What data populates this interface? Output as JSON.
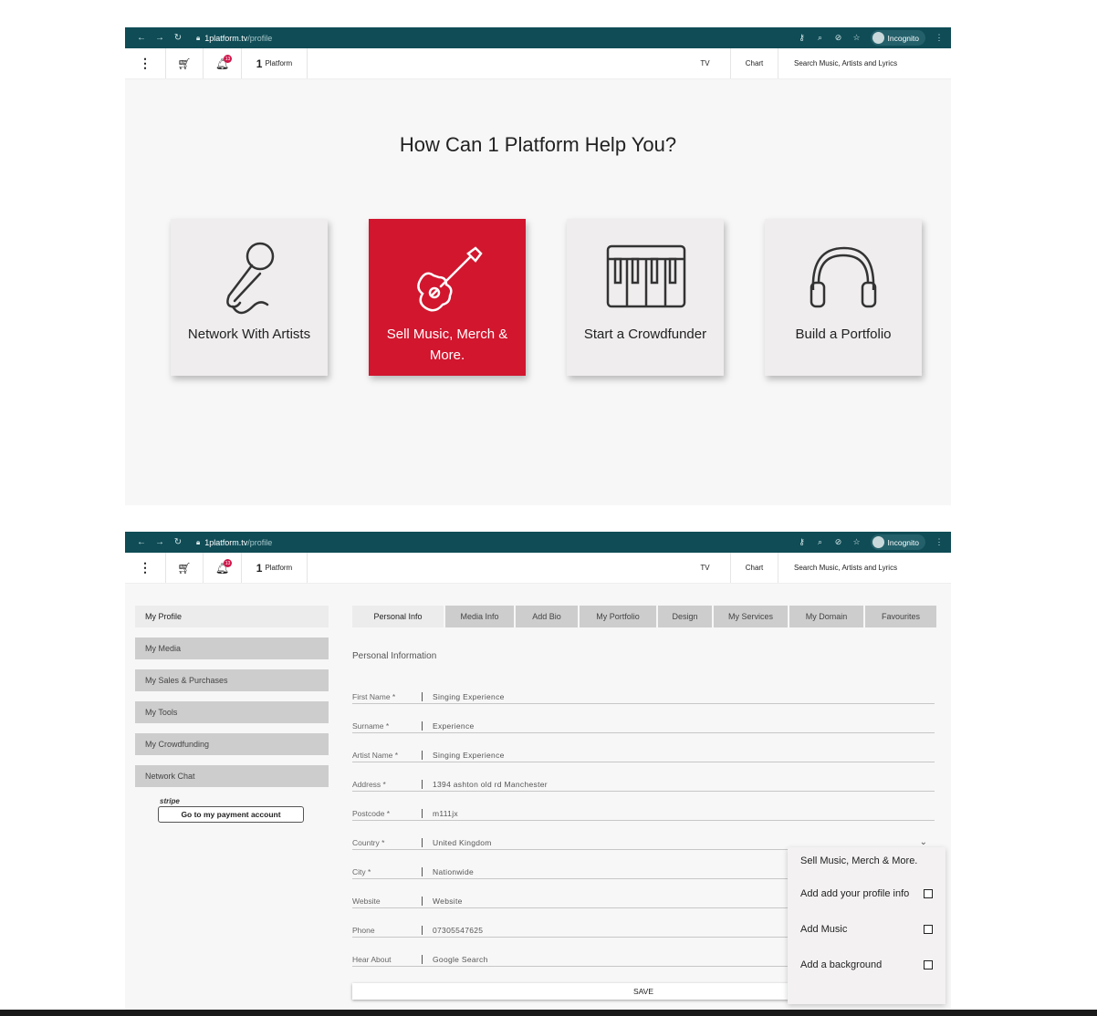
{
  "browser": {
    "url_host": "1platform.tv",
    "url_path": "/profile",
    "incognito_label": "Incognito"
  },
  "sitebar": {
    "logo_mark": "1",
    "logo_text": "Platform",
    "notification_count": "13",
    "tv_label": "TV",
    "chart_label": "Chart",
    "search_placeholder": "Search Music, Artists and Lyrics"
  },
  "help": {
    "title": "How Can 1 Platform Help You?",
    "cards": [
      {
        "label": "Network With Artists",
        "icon": "microphone-icon"
      },
      {
        "label": "Sell Music, Merch & More.",
        "icon": "guitar-icon",
        "active": true
      },
      {
        "label": "Start a Crowdfunder",
        "icon": "piano-keyboard-icon"
      },
      {
        "label": "Build a Portfolio",
        "icon": "headphones-icon"
      }
    ],
    "accent_color": "#d1162e"
  },
  "profile": {
    "nav": [
      "My Profile",
      "My Media",
      "My Sales & Purchases",
      "My Tools",
      "My Crowdfunding",
      "Network Chat"
    ],
    "stripe_label": "stripe",
    "payment_button": "Go to my payment account",
    "tabs": [
      "Personal Info",
      "Media Info",
      "Add Bio",
      "My Portfolio",
      "Design",
      "My Services",
      "My Domain",
      "Favourites"
    ],
    "form_title": "Personal Information",
    "fields": [
      {
        "label": "First Name *",
        "value": "Singing Experience"
      },
      {
        "label": "Surname *",
        "value": "Experience"
      },
      {
        "label": "Artist Name *",
        "value": "Singing Experience"
      },
      {
        "label": "Address *",
        "value": "1394 ashton old rd Manchester"
      },
      {
        "label": "Postcode *",
        "value": "m111jx"
      },
      {
        "label": "Country *",
        "value": "United Kingdom"
      },
      {
        "label": "City *",
        "value": "Nationwide"
      },
      {
        "label": "Website",
        "value": "Website"
      },
      {
        "label": "Phone",
        "value": "07305547625"
      },
      {
        "label": "Hear About",
        "value": "Google Search"
      }
    ],
    "save_label": "SAVE"
  },
  "popup": {
    "title": "Sell Music, Merch & More.",
    "items": [
      "Add add your profile info",
      "Add Music",
      "Add a background"
    ]
  }
}
